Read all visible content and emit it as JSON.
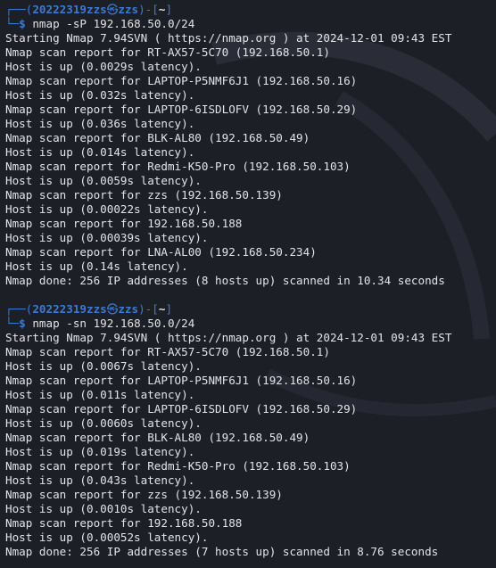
{
  "sessions": [
    {
      "prompt": {
        "frame_open": "┌──(",
        "user": "20222319zzs",
        "at_symbol": "㉿",
        "host": "zzs",
        "frame_mid": ")-[",
        "cwd": "~",
        "frame_close": "]",
        "bottom_frame": "└─",
        "dollar": "$ ",
        "command": "nmap -sP 192.168.50.0/24"
      },
      "output": [
        "Starting Nmap 7.94SVN ( https://nmap.org ) at 2024-12-01 09:43 EST",
        "Nmap scan report for RT-AX57-5C70 (192.168.50.1)",
        "Host is up (0.0029s latency).",
        "Nmap scan report for LAPTOP-P5NMF6J1 (192.168.50.16)",
        "Host is up (0.032s latency).",
        "Nmap scan report for LAPTOP-6ISDLOFV (192.168.50.29)",
        "Host is up (0.036s latency).",
        "Nmap scan report for BLK-AL80 (192.168.50.49)",
        "Host is up (0.014s latency).",
        "Nmap scan report for Redmi-K50-Pro (192.168.50.103)",
        "Host is up (0.0059s latency).",
        "Nmap scan report for zzs (192.168.50.139)",
        "Host is up (0.00022s latency).",
        "Nmap scan report for 192.168.50.188",
        "Host is up (0.00039s latency).",
        "Nmap scan report for LNA-AL00 (192.168.50.234)",
        "Host is up (0.14s latency).",
        "Nmap done: 256 IP addresses (8 hosts up) scanned in 10.34 seconds"
      ]
    },
    {
      "prompt": {
        "frame_open": "┌──(",
        "user": "20222319zzs",
        "at_symbol": "㉿",
        "host": "zzs",
        "frame_mid": ")-[",
        "cwd": "~",
        "frame_close": "]",
        "bottom_frame": "└─",
        "dollar": "$ ",
        "command": "nmap -sn 192.168.50.0/24"
      },
      "output": [
        "Starting Nmap 7.94SVN ( https://nmap.org ) at 2024-12-01 09:43 EST",
        "Nmap scan report for RT-AX57-5C70 (192.168.50.1)",
        "Host is up (0.0067s latency).",
        "Nmap scan report for LAPTOP-P5NMF6J1 (192.168.50.16)",
        "Host is up (0.011s latency).",
        "Nmap scan report for LAPTOP-6ISDLOFV (192.168.50.29)",
        "Host is up (0.0060s latency).",
        "Nmap scan report for BLK-AL80 (192.168.50.49)",
        "Host is up (0.019s latency).",
        "Nmap scan report for Redmi-K50-Pro (192.168.50.103)",
        "Host is up (0.043s latency).",
        "Nmap scan report for zzs (192.168.50.139)",
        "Host is up (0.0010s latency).",
        "Nmap scan report for 192.168.50.188",
        "Host is up (0.00052s latency).",
        "Nmap done: 256 IP addresses (7 hosts up) scanned in 8.76 seconds"
      ]
    }
  ],
  "theme": {
    "background": "#1d1f27",
    "prompt_blue": "#3a7bd5",
    "text": "#e2e4e8"
  }
}
